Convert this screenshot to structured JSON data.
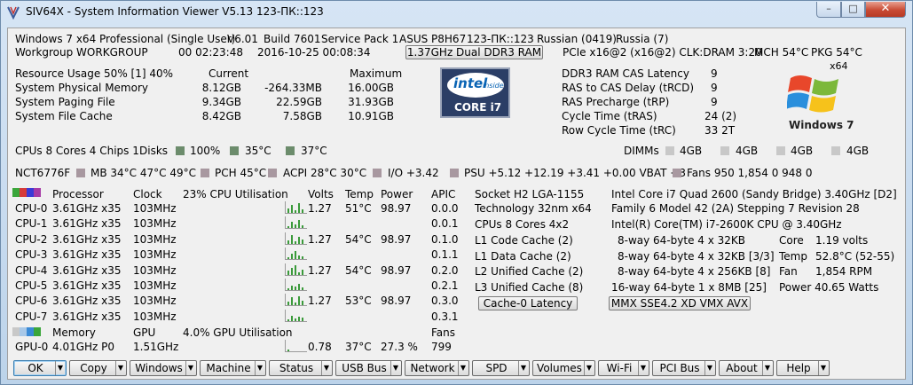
{
  "window": {
    "title": "SIV64X - System Information Viewer V5.13 123-ПК::123",
    "min": "–",
    "max": "□",
    "close": "✕"
  },
  "sys": {
    "os": "Windows 7 x64 Professional (Single User)",
    "ver": "V6.01",
    "build": "Build 7601",
    "sp": "Service Pack 1",
    "board": "ASUS P8H67",
    "host": "123-ПК::123",
    "lang": "Russian (0419)",
    "region": "Russia (7)",
    "workgroup": "Workgroup WORKGROUP",
    "uptime": "00 02:23:48",
    "date": "2016-10-25 00:08:34",
    "mem_button": "1.37GHz Dual DDR3 RAM",
    "pcie": "PCIe x16@2 (x16@2) CLK:DRAM 3:20",
    "mch": "MCH 54°C",
    "pkg": "PKG 54°C"
  },
  "res": {
    "header": "Resource Usage 50% [1] 40%",
    "current": "Current",
    "maximum": "Maximum",
    "rows": [
      {
        "label": "System Physical Memory",
        "cur": "8.12GB",
        "delta": "-264.33MB",
        "max": "16.00GB"
      },
      {
        "label": "System Paging File",
        "cur": "9.34GB",
        "delta": "22.59GB",
        "max": "31.93GB"
      },
      {
        "label": "System File Cache",
        "cur": "8.42GB",
        "delta": "7.58GB",
        "max": "10.91GB"
      }
    ]
  },
  "ram": {
    "rows": [
      {
        "label": "DDR3 RAM CAS Latency",
        "val": "9"
      },
      {
        "label": "RAS to CAS Delay (tRCD)",
        "val": "9"
      },
      {
        "label": "RAS Precharge (tRP)",
        "val": "9"
      },
      {
        "label": "Cycle Time (tRAS)",
        "val": "24 (2)"
      },
      {
        "label": "Row Cycle Time (tRC)",
        "val": "33 2T"
      }
    ]
  },
  "logos": {
    "intel_text": "intel",
    "intel_inside": "inside",
    "intel_model": "CORE i7",
    "win_x64": "x64",
    "win_text": "Windows 7"
  },
  "status": {
    "cpus": "CPUs 8 Cores 4 Chips 1",
    "disks": "Disks",
    "d1": "100%",
    "d2": "35°C",
    "d3": "37°C",
    "dimms": "DIMMs",
    "g1": "4GB",
    "g2": "4GB",
    "g3": "4GB",
    "g4": "4GB"
  },
  "sensors": {
    "chip": "NCT6776F",
    "mb": "MB 34°C 47°C 49°C",
    "pch": "PCH 45°C",
    "acpi": "ACPI 28°C 30°C",
    "io": "I/O +3.42",
    "psu": "PSU +5.12 +12.19 +3.41 +0.00 VBAT +3",
    "fans": "Fans 950 1,854 0 948 0"
  },
  "cpu": {
    "headers": {
      "processor": "Processor",
      "clock": "Clock",
      "util": "23% CPU Utilisation",
      "volts": "Volts",
      "temp": "Temp",
      "power": "Power",
      "apic": "APIC"
    },
    "rows": [
      {
        "name": "CPU-0",
        "freq": "3.61GHz x35",
        "clock": "103MHz",
        "volts": "1.27",
        "temp": "51°C",
        "power": "98.97",
        "apic": "0.0.0"
      },
      {
        "name": "CPU-1",
        "freq": "3.61GHz x35",
        "clock": "103MHz",
        "volts": "",
        "temp": "",
        "power": "",
        "apic": "0.0.1"
      },
      {
        "name": "CPU-2",
        "freq": "3.61GHz x35",
        "clock": "103MHz",
        "volts": "1.27",
        "temp": "54°C",
        "power": "98.97",
        "apic": "0.1.0"
      },
      {
        "name": "CPU-3",
        "freq": "3.61GHz x35",
        "clock": "103MHz",
        "volts": "",
        "temp": "",
        "power": "",
        "apic": "0.1.1"
      },
      {
        "name": "CPU-4",
        "freq": "3.61GHz x35",
        "clock": "103MHz",
        "volts": "1.27",
        "temp": "54°C",
        "power": "98.97",
        "apic": "0.2.0"
      },
      {
        "name": "CPU-5",
        "freq": "3.61GHz x35",
        "clock": "103MHz",
        "volts": "",
        "temp": "",
        "power": "",
        "apic": "0.2.1"
      },
      {
        "name": "CPU-6",
        "freq": "3.61GHz x35",
        "clock": "103MHz",
        "volts": "1.27",
        "temp": "53°C",
        "power": "98.97",
        "apic": "0.3.0"
      },
      {
        "name": "CPU-7",
        "freq": "3.61GHz x35",
        "clock": "103MHz",
        "volts": "",
        "temp": "",
        "power": "",
        "apic": "0.3.1"
      }
    ]
  },
  "gpu": {
    "memory": "Memory",
    "gpu": "GPU",
    "util": "4.0% GPU Utilisation",
    "fans": "Fans",
    "name": "GPU-0",
    "freq": "4.01GHz P0",
    "clock": "1.51GHz",
    "volts": "0.78",
    "temp": "37°C",
    "power": "27.3 %",
    "fanval": "799"
  },
  "proc": {
    "socket": "Socket H2 LGA-1155",
    "tech": "Technology 32nm  x64",
    "cores": "CPUs 8 Cores 4x2",
    "l1c": "L1 Code Cache (2)",
    "l1d": "L1 Data Cache (2)",
    "l2": "L2 Unified Cache (2)",
    "l3": "L3 Unified Cache (8)",
    "cache_btn": "Cache-0 Latency",
    "model": "Intel Core i7 Quad 2600 (Sandy Bridge) 3.40GHz [D2]",
    "family": "Family 6  Model 42 (2A)  Stepping 7  Revision 28",
    "brand": "Intel(R) Core(TM) i7-2600K CPU @ 3.40GHz",
    "c1": "8-way 64-byte  4 x 32KB",
    "c2": "8-way 64-byte  4 x 32KB [3/3]",
    "c3": "8-way 64-byte  4 x 256KB [8]",
    "c4": "16-way 64-byte  1 x 8MB  [25]",
    "isa_btn": "MMX SSE4.2 XD VMX AVX",
    "core": "Core",
    "core_v": "1.19 volts",
    "temp": "Temp",
    "temp_v": "52.8°C (52-55)",
    "fan": "Fan",
    "fan_v": "1,854 RPM",
    "power": "Power 40.65 Watts"
  },
  "toolbar": [
    "OK",
    "Copy",
    "Windows",
    "Machine",
    "Status",
    "USB Bus",
    "Network",
    "SPD",
    "Volumes",
    "Wi-Fi",
    "PCI Bus",
    "About",
    "Help"
  ]
}
